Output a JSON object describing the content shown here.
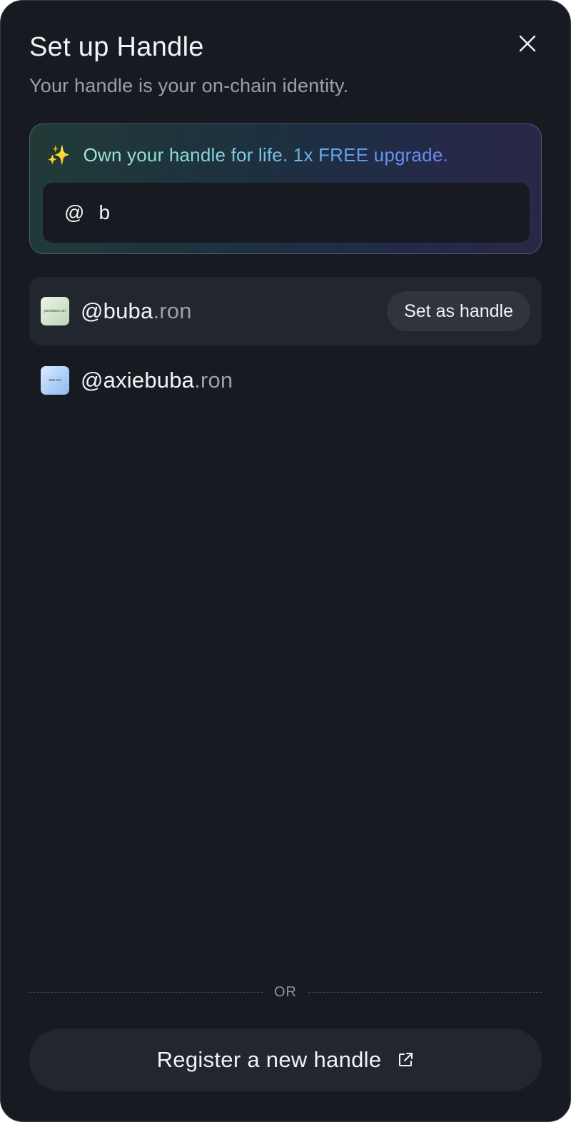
{
  "dialog": {
    "title": "Set up Handle",
    "subtitle": "Your handle is your on-chain identity."
  },
  "promo": {
    "sparkle_icon": "sparkles-icon",
    "text": "Own your handle for life. 1x FREE upgrade.",
    "input_prefix": "@",
    "input_value": "b"
  },
  "results": [
    {
      "name": "@buba",
      "suffix": ".ron",
      "avatar_caption": "juneidasn.ron",
      "action_label": "Set as handle"
    },
    {
      "name": "@axiebuba",
      "suffix": ".ron",
      "avatar_caption": "axie.ron"
    }
  ],
  "divider": {
    "label": "OR"
  },
  "register": {
    "label": "Register a new handle",
    "icon": "external-link-icon"
  },
  "colors": {
    "background": "#171a21",
    "surface": "#22262f",
    "text_primary": "#f2f3f5",
    "text_secondary": "#9aa0ab",
    "gradient_start": "#a4ead5",
    "gradient_end": "#6f86f3"
  }
}
